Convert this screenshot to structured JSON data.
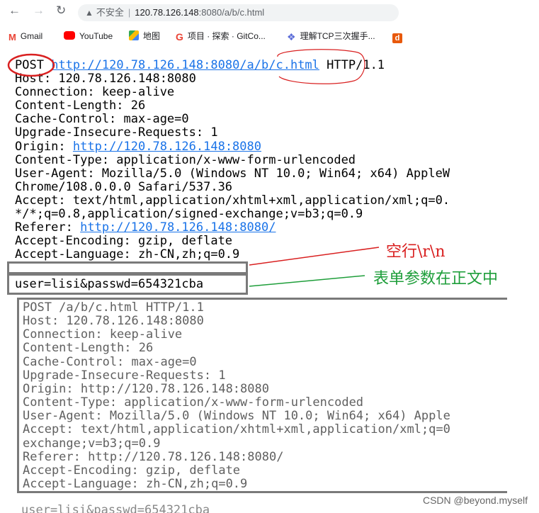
{
  "browser": {
    "address": {
      "insecure_label": "不安全",
      "host": "120.78.126.148",
      "rest": ":8080/a/b/c.html"
    },
    "bookmarks": [
      {
        "label": "Gmail",
        "icon": "gmail-icon",
        "color": "#EA4335"
      },
      {
        "label": "YouTube",
        "icon": "youtube-icon",
        "color": "#FF0000"
      },
      {
        "label": "地图",
        "icon": "maps-icon",
        "color": "#34A853"
      },
      {
        "label": "项目 · 探索 · GitCo...",
        "icon": "google-icon",
        "color": "#4285F4"
      },
      {
        "label": "理解TCP三次握手...",
        "icon": "bookmark-diamond-icon",
        "color": "#5B6CD8"
      }
    ]
  },
  "request": {
    "method": "POST",
    "url": "http://120.78.126.148:8080/a/b/c.html",
    "version": "HTTP/1.1",
    "host_line": "Host: 120.78.126.148:8080",
    "connection_line": "Connection: keep-alive",
    "content_length_line": "Content-Length: 26",
    "cache_control_line": "Cache-Control: max-age=0",
    "upgrade_line": "Upgrade-Insecure-Requests: 1",
    "origin_label": "Origin: ",
    "origin_url": "http://120.78.126.148:8080",
    "content_type_line": "Content-Type: application/x-www-form-urlencoded",
    "user_agent_line": "User-Agent: Mozilla/5.0 (Windows NT 10.0; Win64; x64) AppleW",
    "user_agent_cont": "Chrome/108.0.0.0 Safari/537.36",
    "accept_line": "Accept: text/html,application/xhtml+xml,application/xml;q=0.",
    "accept_cont": "*/*;q=0.8,application/signed-exchange;v=b3;q=0.9",
    "referer_label": "Referer: ",
    "referer_url": "http://120.78.126.148:8080/",
    "accept_encoding_line": "Accept-Encoding: gzip, deflate",
    "accept_language_line": "Accept-Language: zh-CN,zh;q=0.9",
    "body": "user=lisi&passwd=654321cba"
  },
  "raw_request": {
    "lines": [
      "POST /a/b/c.html HTTP/1.1",
      "Host: 120.78.126.148:8080",
      "Connection: keep-alive",
      "Content-Length: 26",
      "Cache-Control: max-age=0",
      "Upgrade-Insecure-Requests: 1",
      "Origin: http://120.78.126.148:8080",
      "Content-Type: application/x-www-form-urlencoded",
      "User-Agent: Mozilla/5.0 (Windows NT 10.0; Win64; x64) Apple",
      "Accept: text/html,application/xhtml+xml,application/xml;q=0",
      "exchange;v=b3;q=0.9",
      "Referer: http://120.78.126.148:8080/",
      "Accept-Encoding: gzip, deflate",
      "Accept-Language: zh-CN,zh;q=0.9"
    ],
    "cut_line": "user=lisi&passwd=654321cba"
  },
  "annotations": {
    "blank_line": "空行\\r\\n",
    "form_params": "表单参数在正文中",
    "red_color": "#D92020",
    "green_color": "#1E9E3A"
  },
  "watermark": "CSDN @beyond.myself"
}
